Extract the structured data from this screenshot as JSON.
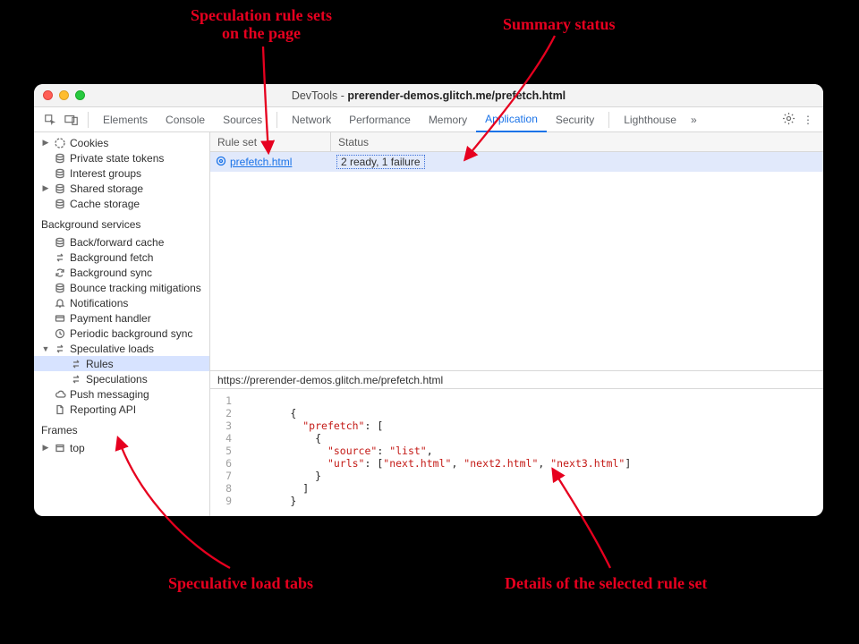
{
  "annotations": {
    "rule_sets": "Speculation rule sets\non the page",
    "summary_status": "Summary status",
    "load_tabs": "Speculative load tabs",
    "details": "Details of the selected rule set"
  },
  "window": {
    "title_prefix": "DevTools - ",
    "title_bold": "prerender-demos.glitch.me/prefetch.html",
    "tabs": {
      "elements": "Elements",
      "console": "Console",
      "sources": "Sources",
      "network": "Network",
      "performance": "Performance",
      "memory": "Memory",
      "application": "Application",
      "security": "Security",
      "lighthouse": "Lighthouse"
    }
  },
  "sidebar": {
    "storage": {
      "cookies": "Cookies",
      "pst": "Private state tokens",
      "interest": "Interest groups",
      "shared": "Shared storage",
      "cache": "Cache storage"
    },
    "bg_head": "Background services",
    "bg": {
      "bfcache": "Back/forward cache",
      "bgfetch": "Background fetch",
      "bgsync": "Background sync",
      "bounce": "Bounce tracking mitigations",
      "notif": "Notifications",
      "payment": "Payment handler",
      "periodic": "Periodic background sync",
      "specloads": "Speculative loads",
      "rules": "Rules",
      "speculations": "Speculations",
      "push": "Push messaging",
      "reporting": "Reporting API"
    },
    "frames_head": "Frames",
    "frames_top": "top"
  },
  "table": {
    "col_rule": "Rule set",
    "col_status": "Status",
    "row1_rule": "prefetch.html",
    "row1_status": "2 ready, 1 failure"
  },
  "details": {
    "url": "https://prerender-demos.glitch.me/prefetch.html",
    "lines": [
      "1",
      "2",
      "3",
      "4",
      "5",
      "6",
      "7",
      "8",
      "9"
    ],
    "json": {
      "key_prefetch": "\"prefetch\"",
      "key_source": "\"source\"",
      "val_source": "\"list\"",
      "key_urls": "\"urls\"",
      "url1": "\"next.html\"",
      "url2": "\"next2.html\"",
      "url3": "\"next3.html\""
    }
  }
}
